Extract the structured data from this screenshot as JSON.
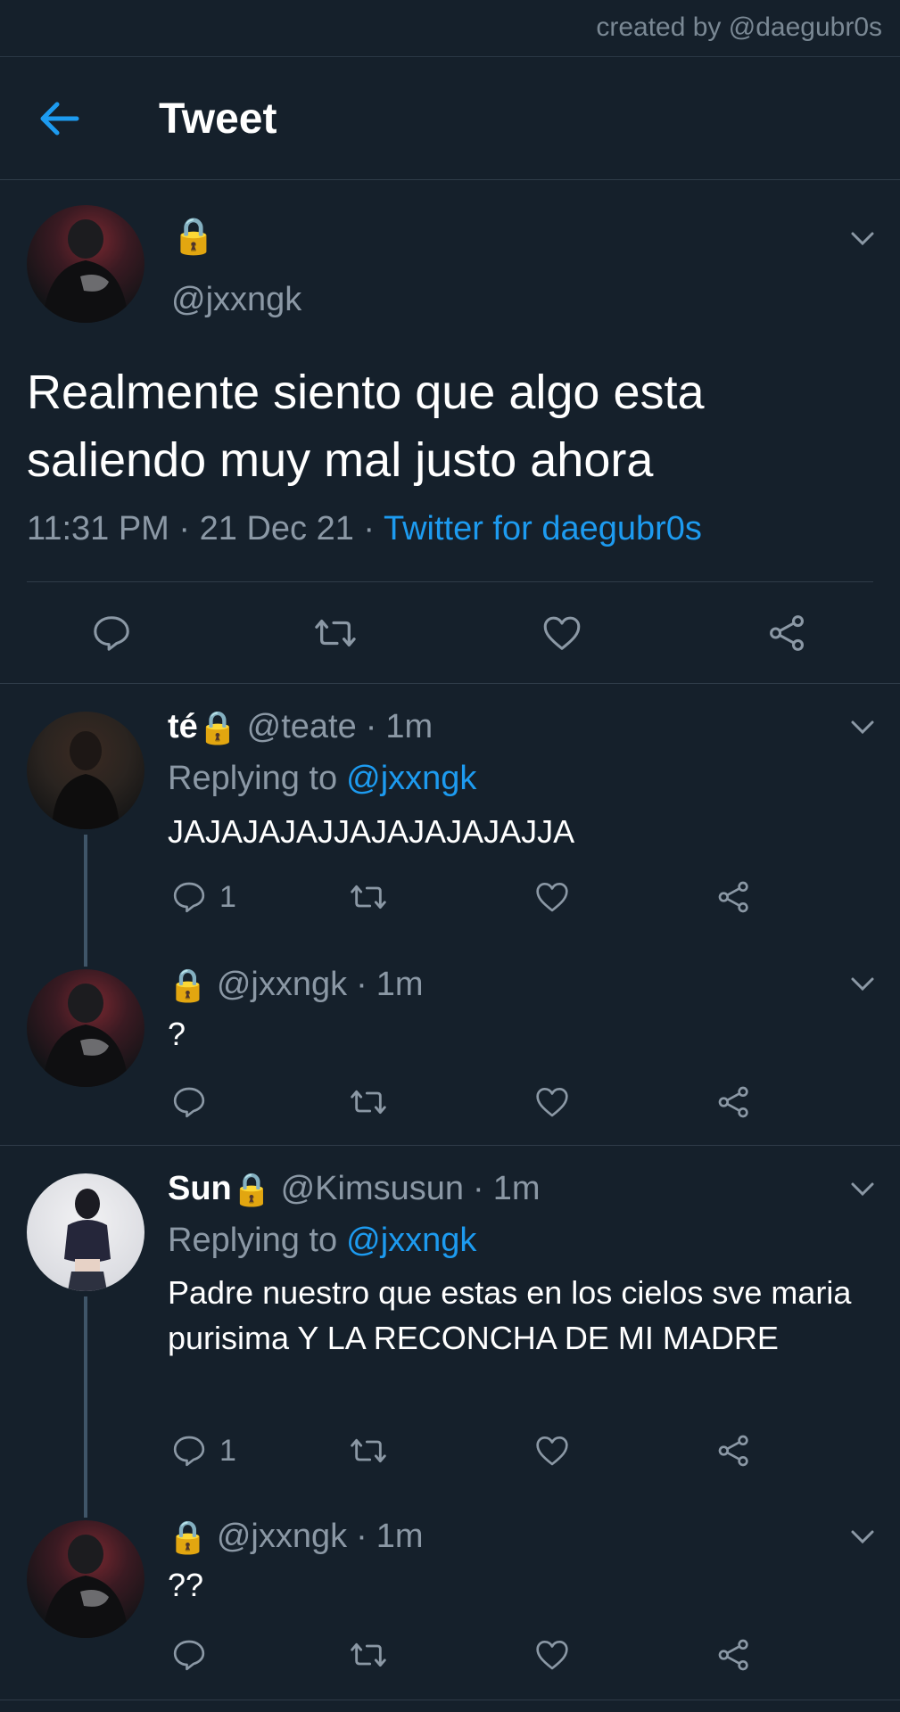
{
  "credit": "created by @daegubr0s",
  "header": {
    "title": "Tweet"
  },
  "main_tweet": {
    "name_icon": "lock-emoji",
    "lock": "🔒",
    "handle": "@jxxngk",
    "text": "Realmente siento que algo esta saliendo muy mal justo ahora",
    "time": "11:31 PM",
    "sep": "·",
    "date": "21 Dec 21",
    "source": "Twitter for daegubr0s"
  },
  "replies": [
    {
      "name": "té",
      "lock": "🔒",
      "handle": "@teate",
      "time_sep": "·",
      "time": "1m",
      "replying_prefix": "Replying to",
      "replying_to": "@jxxngk",
      "text": "JAJAJAJAJJAJAJAJAJAJJA",
      "reply_count": "1"
    },
    {
      "name": "",
      "lock": "🔒",
      "handle": "@jxxngk",
      "time_sep": "·",
      "time": "1m",
      "text": "?",
      "reply_count": ""
    },
    {
      "name": "Sun",
      "lock": "🔒",
      "handle": "@Kimsusun",
      "time_sep": "·",
      "time": "1m",
      "replying_prefix": "Replying to",
      "replying_to": "@jxxngk",
      "text": "Padre nuestro que estas en los cielos sve maria purisima Y LA RECONCHA DE MI MADRE",
      "reply_count": "1"
    },
    {
      "name": "",
      "lock": "🔒",
      "handle": "@jxxngk",
      "time_sep": "·",
      "time": "1m",
      "text": "??",
      "reply_count": ""
    }
  ],
  "colors": {
    "background": "#15202b",
    "accent": "#1d9bf0",
    "muted": "#8b98a5",
    "divider": "#2f3c49"
  }
}
